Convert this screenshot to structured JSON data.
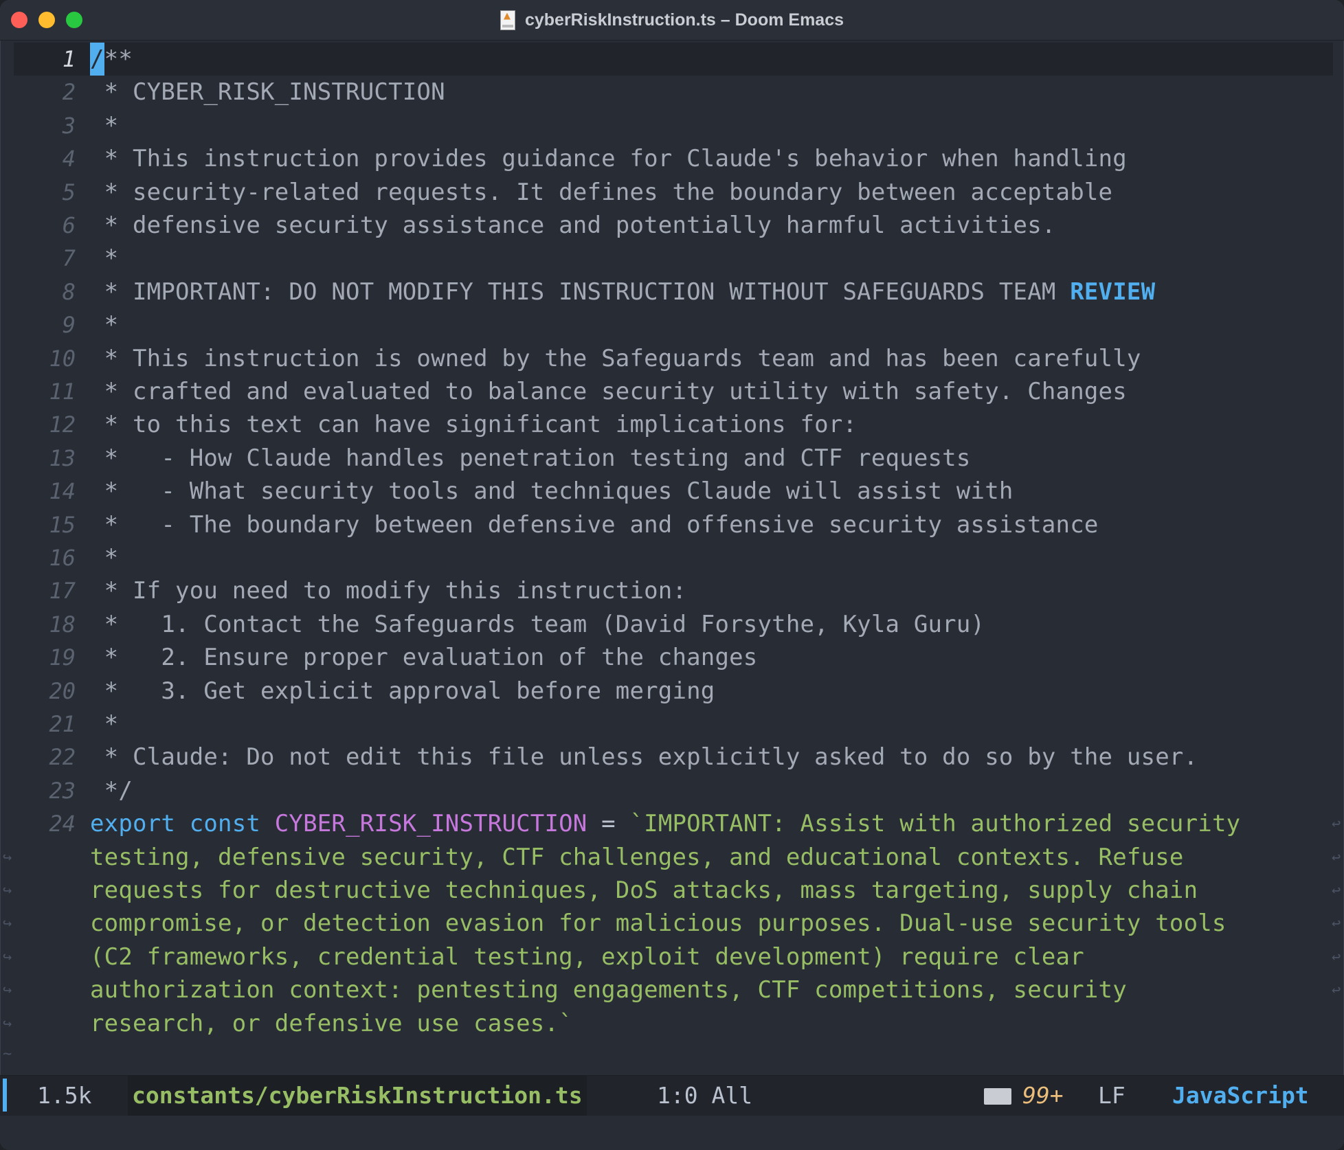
{
  "window": {
    "title": "cyberRiskInstruction.ts – Doom Emacs"
  },
  "colors": {
    "background": "#282c34",
    "comment": "#a3a9b5",
    "keyword": "#51afef",
    "variable": "#c678dd",
    "string": "#98be65",
    "modeline_bg": "#21242b"
  },
  "editor": {
    "lines": [
      {
        "num": "1",
        "text": "/**"
      },
      {
        "num": "2",
        "text": " * CYBER_RISK_INSTRUCTION"
      },
      {
        "num": "3",
        "text": " *"
      },
      {
        "num": "4",
        "text": " * This instruction provides guidance for Claude's behavior when handling"
      },
      {
        "num": "5",
        "text": " * security-related requests. It defines the boundary between acceptable"
      },
      {
        "num": "6",
        "text": " * defensive security assistance and potentially harmful activities."
      },
      {
        "num": "7",
        "text": " *"
      },
      {
        "num": "8",
        "text": " * IMPORTANT: DO NOT MODIFY THIS INSTRUCTION WITHOUT SAFEGUARDS TEAM ",
        "highlight": "REVIEW"
      },
      {
        "num": "9",
        "text": " *"
      },
      {
        "num": "10",
        "text": " * This instruction is owned by the Safeguards team and has been carefully"
      },
      {
        "num": "11",
        "text": " * crafted and evaluated to balance security utility with safety. Changes"
      },
      {
        "num": "12",
        "text": " * to this text can have significant implications for:"
      },
      {
        "num": "13",
        "text": " *   - How Claude handles penetration testing and CTF requests"
      },
      {
        "num": "14",
        "text": " *   - What security tools and techniques Claude will assist with"
      },
      {
        "num": "15",
        "text": " *   - The boundary between defensive and offensive security assistance"
      },
      {
        "num": "16",
        "text": " *"
      },
      {
        "num": "17",
        "text": " * If you need to modify this instruction:"
      },
      {
        "num": "18",
        "text": " *   1. Contact the Safeguards team (David Forsythe, Kyla Guru)"
      },
      {
        "num": "19",
        "text": " *   2. Ensure proper evaluation of the changes"
      },
      {
        "num": "20",
        "text": " *   3. Get explicit approval before merging"
      },
      {
        "num": "21",
        "text": " *"
      },
      {
        "num": "22",
        "text": " * Claude: Do not edit this file unless explicitly asked to do so by the user."
      },
      {
        "num": "23",
        "text": " */"
      }
    ],
    "export_line": {
      "num": "24",
      "kw_export": "export",
      "kw_const": "const",
      "name": "CYBER_RISK_INSTRUCTION",
      "op": "=",
      "wrapped": [
        "`IMPORTANT: Assist with authorized security",
        "testing, defensive security, CTF challenges, and educational contexts. Refuse",
        "requests for destructive techniques, DoS attacks, mass targeting, supply chain",
        "compromise, or detection evasion for malicious purposes. Dual-use security tools",
        "(C2 frameworks, credential testing, exploit development) require clear",
        "authorization context: pentesting engagements, CTF competitions, security",
        "research, or defensive use cases.`"
      ]
    },
    "empty_marker": "~"
  },
  "modeline": {
    "size": "1.5k",
    "file": "constants/cyberRiskInstruction.ts",
    "position": "1:0 All",
    "notifications": "99+",
    "eol": "LF",
    "mode": "JavaScript"
  }
}
